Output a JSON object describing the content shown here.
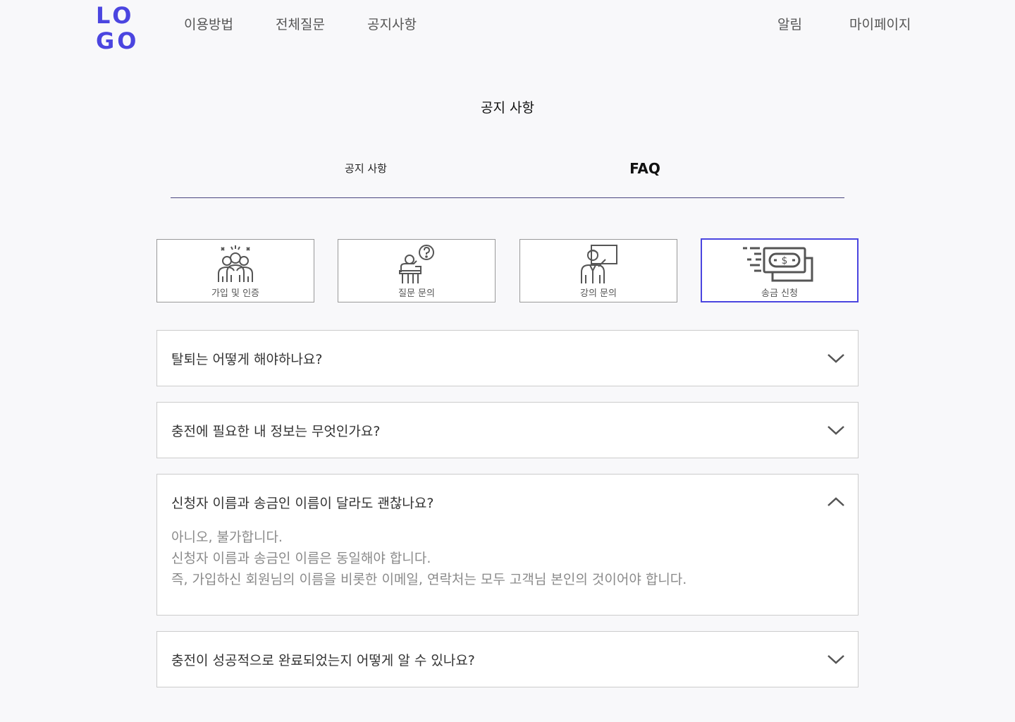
{
  "header": {
    "logo_line1": "LO",
    "logo_line2": "GO",
    "nav": [
      "이용방법",
      "전체질문",
      "공지사항"
    ],
    "right_nav": [
      "알림",
      "마이페이지"
    ]
  },
  "page_title": "공지 사항",
  "tabs": {
    "notice": "공지 사항",
    "faq": "FAQ",
    "active": "FAQ"
  },
  "categories": [
    {
      "label": "가입 및 인증",
      "icon": "group-users-icon"
    },
    {
      "label": "질문 문의",
      "icon": "question-person-icon"
    },
    {
      "label": "강의 문의",
      "icon": "lecture-teacher-icon"
    },
    {
      "label": "송금 신청",
      "icon": "money-transfer-icon",
      "active": true
    }
  ],
  "faq": [
    {
      "question": "탈퇴는 어떻게 해야하나요?",
      "expanded": false
    },
    {
      "question": "충전에 필요한 내 정보는 무엇인가요?",
      "expanded": false
    },
    {
      "question": "신청자 이름과 송금인 이름이 달라도 괜찮나요?",
      "expanded": true,
      "answer": [
        "아니오, 불가합니다.",
        "신청자 이름과 송금인 이름은 동일해야 합니다.",
        "즉, 가입하신 회원님의 이름을 비롯한 이메일, 연락처는 모두 고객님 본인의 것이어야 합니다."
      ]
    },
    {
      "question": "충전이 성공적으로 완료되었는지 어떻게 알 수 있나요?",
      "expanded": false
    }
  ],
  "colors": {
    "accent": "#4b45e0",
    "tab_underline": "#4a4680",
    "background": "#f8f8fa"
  }
}
